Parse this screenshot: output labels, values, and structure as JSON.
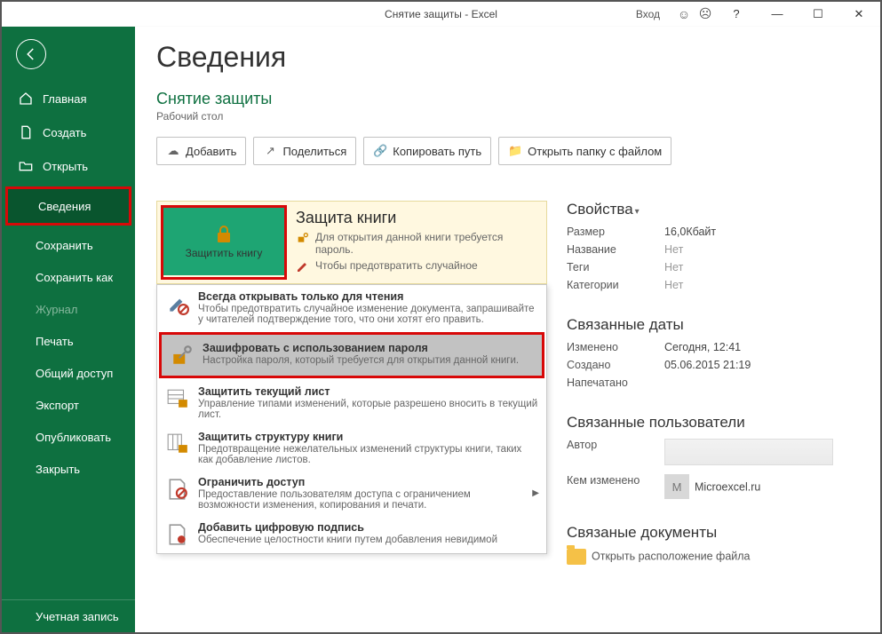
{
  "titlebar": {
    "title": "Снятие защиты  -  Excel",
    "login": "Вход"
  },
  "sidebar": {
    "home": "Главная",
    "new": "Создать",
    "open": "Открыть",
    "info": "Сведения",
    "save": "Сохранить",
    "saveas": "Сохранить как",
    "journal": "Журнал",
    "print": "Печать",
    "share": "Общий доступ",
    "export": "Экспорт",
    "publish": "Опубликовать",
    "close": "Закрыть",
    "account": "Учетная запись"
  },
  "main": {
    "title": "Сведения",
    "subtitle": "Снятие защиты",
    "location": "Рабочий стол",
    "toolbar": {
      "add": "Добавить",
      "share": "Поделиться",
      "copypath": "Копировать путь",
      "openfolder": "Открыть папку с файлом"
    },
    "protect": {
      "button": "Защитить книгу",
      "heading": "Защита книги",
      "line1": "Для открытия данной книги требуется пароль.",
      "line2": "Чтобы предотвратить случайное"
    },
    "dd": {
      "i1": {
        "t": "Всегда открывать только для чтения",
        "a": "ч",
        "d": "Чтобы предотвратить случайное изменение документа, запрашивайте у читателей подтверждение того, что они хотят его править."
      },
      "i2": {
        "t": "Зашифровать с использованием пароля",
        "d": "Настройка пароля, который требуется для открытия данной книги."
      },
      "i3": {
        "t": "Защитить текущий лист",
        "a": "т",
        "d": "Управление типами изменений, которые разрешено вносить в текущий лист."
      },
      "i4": {
        "t": "Защитить структуру книги",
        "a": "с",
        "d": "Предотвращение нежелательных изменений структуры книги, таких как добавление листов."
      },
      "i5": {
        "t": "Ограничить доступ",
        "a": "О",
        "d": "Предоставление пользователям доступа с ограничением возможности изменения, копирования и печати."
      },
      "i6": {
        "t": "Добавить цифровую подпись",
        "a": "Д",
        "d": "Обеспечение целостности книги путем добавления невидимой"
      }
    }
  },
  "props": {
    "h_props": "Свойства",
    "size_k": "Размер",
    "size_v": "16,0Кбайт",
    "name_k": "Название",
    "name_v": "Нет",
    "tags_k": "Теги",
    "tags_v": "Нет",
    "cat_k": "Категории",
    "cat_v": "Нет",
    "h_dates": "Связанные даты",
    "mod_k": "Изменено",
    "mod_v": "Сегодня, 12:41",
    "cre_k": "Создано",
    "cre_v": "05.06.2015 21:19",
    "prn_k": "Напечатано",
    "h_users": "Связанные пользователи",
    "author_k": "Автор",
    "chby_k": "Кем изменено",
    "chby_v": "Microexcel.ru",
    "chby_i": "М",
    "h_docs": "Связаные документы",
    "openloc": "Открыть расположение файла"
  }
}
